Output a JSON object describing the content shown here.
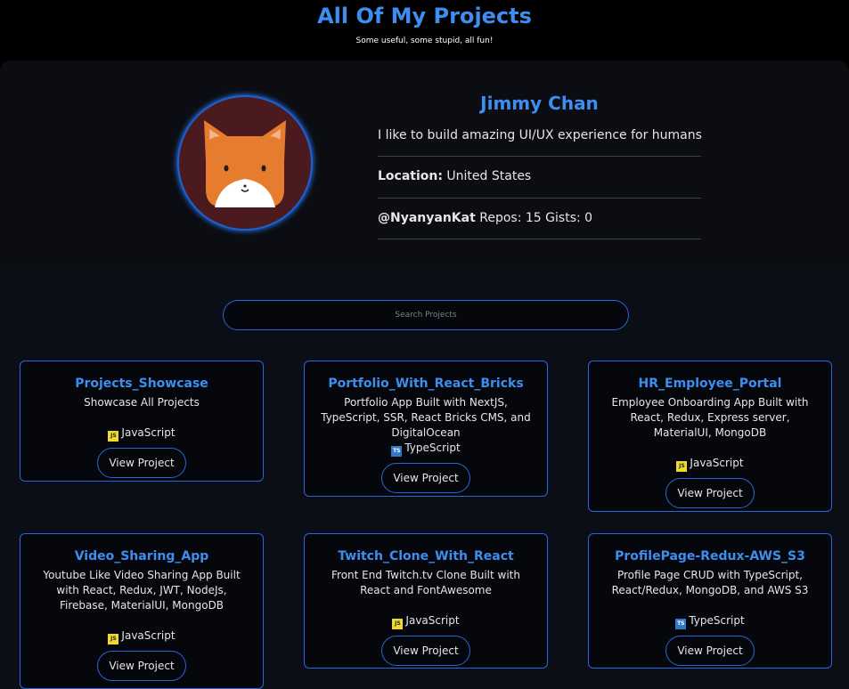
{
  "header": {
    "title": "All Of My Projects",
    "subtitle": "Some useful, some stupid, all fun!"
  },
  "profile": {
    "name": "Jimmy Chan",
    "bio": "I like to build amazing UI/UX experience for humans",
    "location_label": "Location:",
    "location_value": "United States",
    "username": "@NyanyanKat",
    "repos_label": "Repos:",
    "repos_count": "15",
    "gists_label": "Gists:",
    "gists_count": "0",
    "avatar_icon": "fox-avatar-icon"
  },
  "search": {
    "placeholder": "Search Projects",
    "value": ""
  },
  "projects": [
    {
      "title": "Projects_Showcase",
      "description": "Showcase All Projects",
      "language": "JavaScript",
      "language_icon": "JS",
      "button": "View Project"
    },
    {
      "title": "Portfolio_With_React_Bricks",
      "description": "Portfolio App Built with NextJS, TypeScript, SSR, React Bricks CMS, and DigitalOcean",
      "language": "TypeScript",
      "language_icon": "TS",
      "button": "View Project"
    },
    {
      "title": "HR_Employee_Portal",
      "description": "Employee Onboarding App Built with React, Redux, Express server, MaterialUI, MongoDB",
      "language": "JavaScript",
      "language_icon": "JS",
      "button": "View Project"
    },
    {
      "title": "Video_Sharing_App",
      "description": "Youtube Like Video Sharing App Built with React, Redux, JWT, NodeJs, Firebase, MaterialUI, MongoDB",
      "language": "JavaScript",
      "language_icon": "JS",
      "button": "View Project"
    },
    {
      "title": "Twitch_Clone_With_React",
      "description": "Front End Twitch.tv Clone Built with React and FontAwesome",
      "language": "JavaScript",
      "language_icon": "JS",
      "button": "View Project"
    },
    {
      "title": "ProfilePage-Redux-AWS_S3",
      "description": "Profile Page CRUD with TypeScript, React/Redux, MongoDB, and AWS S3",
      "language": "TypeScript",
      "language_icon": "TS",
      "button": "View Project"
    }
  ],
  "colors": {
    "accent": "#3d8ef0",
    "border": "#2a66d9",
    "background": "#0b0e17",
    "card_background": "#05070c",
    "javascript": "#f1d92b",
    "typescript": "#3178c6"
  }
}
